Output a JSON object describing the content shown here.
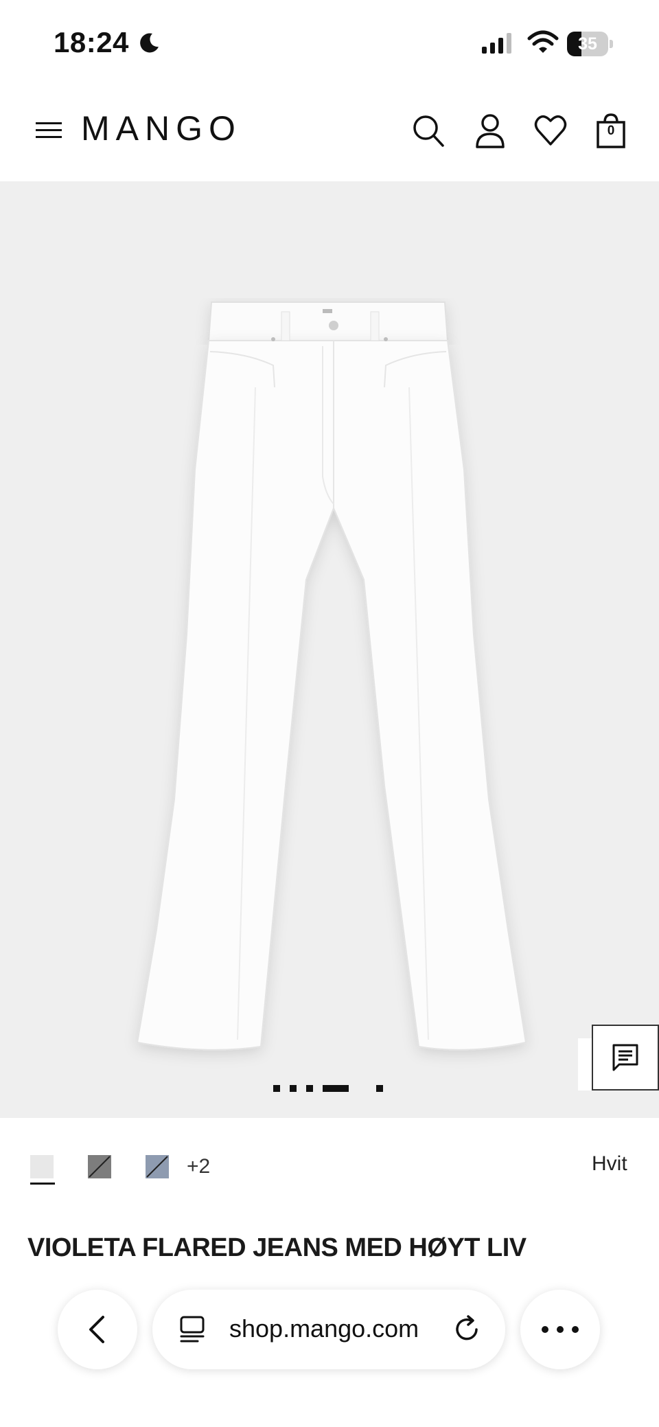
{
  "status_bar": {
    "time": "18:24",
    "battery": "35",
    "battery_level_percent": 35,
    "icons": [
      "moon-icon",
      "cellular-signal-icon",
      "wifi-icon",
      "battery-icon"
    ]
  },
  "header": {
    "logo": "MANGO",
    "bag_count": "0",
    "icons": [
      "menu-icon",
      "search-icon",
      "account-icon",
      "heart-icon",
      "shopping-bag-icon"
    ]
  },
  "gallery": {
    "image": "white flared jeans",
    "pager_active_index": 3,
    "pager_count": 5
  },
  "colors": {
    "swatches": [
      {
        "name": "white",
        "color": "#e8e8e8",
        "selected": true
      },
      {
        "name": "grey",
        "color": "#7d7d7d",
        "selected": false
      },
      {
        "name": "blue-grey",
        "color": "#8e9bb0",
        "selected": false
      }
    ],
    "more": "+2",
    "selected_name": "Hvit"
  },
  "product": {
    "title": "VIOLETA FLARED JEANS MED HØYT LIV"
  },
  "browser_bar": {
    "url": "shop.mango.com",
    "icons": [
      "back-chevron-icon",
      "tabs-icon",
      "reload-icon",
      "more-dots-icon"
    ]
  }
}
